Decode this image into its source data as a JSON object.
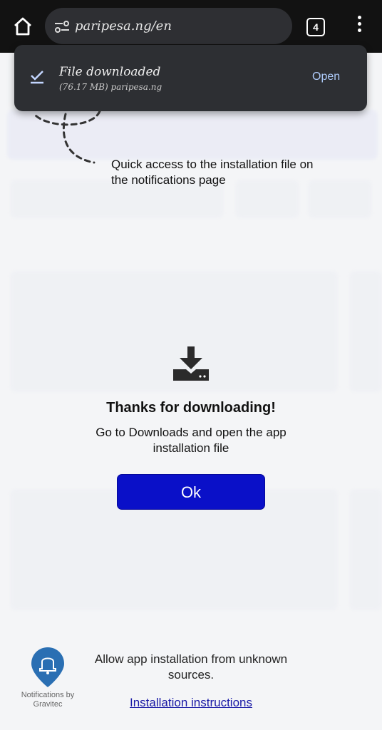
{
  "browser": {
    "url": "paripesa.ng/en",
    "tab_count": "4"
  },
  "download_notification": {
    "title": "File downloaded",
    "subtitle": "(76.17 MB) paripesa.ng",
    "action": "Open"
  },
  "hint": "Quick access to the installation file on the notifications page",
  "dialog": {
    "title": "Thanks for downloading!",
    "message": "Go to Downloads and open the app installation file",
    "ok_label": "Ok"
  },
  "footer": {
    "notifications_by": "Notifications by Gravitec",
    "allow_text": "Allow app installation from unknown sources.",
    "instructions_link": "Installation instructions"
  },
  "colors": {
    "ok_button": "#0a10c8",
    "link": "#1a1aa6",
    "bell": "#2a6fb3"
  }
}
